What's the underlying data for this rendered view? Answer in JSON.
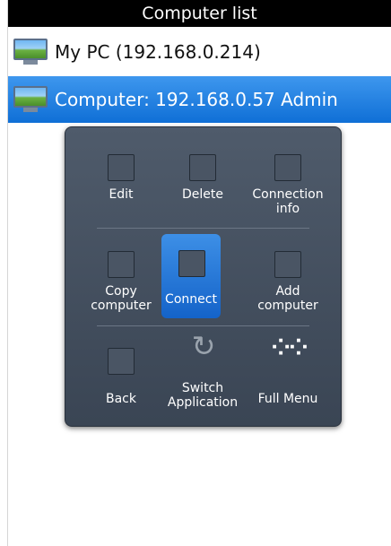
{
  "window": {
    "title": "Computer list"
  },
  "list": {
    "items": [
      {
        "label": "My PC (192.168.0.214)",
        "selected": false
      },
      {
        "label": "Computer: 192.168.0.57 Admin",
        "selected": true
      }
    ]
  },
  "menu": {
    "row1": {
      "edit": "Edit",
      "delete": "Delete",
      "connection_info": "Connection info"
    },
    "row2": {
      "copy": "Copy computer",
      "connect": "Connect",
      "add": "Add computer"
    },
    "row3": {
      "back": "Back",
      "switch": "Switch Application",
      "full_menu": "Full Menu"
    }
  },
  "colors": {
    "selection": "#1f7fe0",
    "title_bg": "#000000",
    "popup_bg": "#45505f"
  }
}
